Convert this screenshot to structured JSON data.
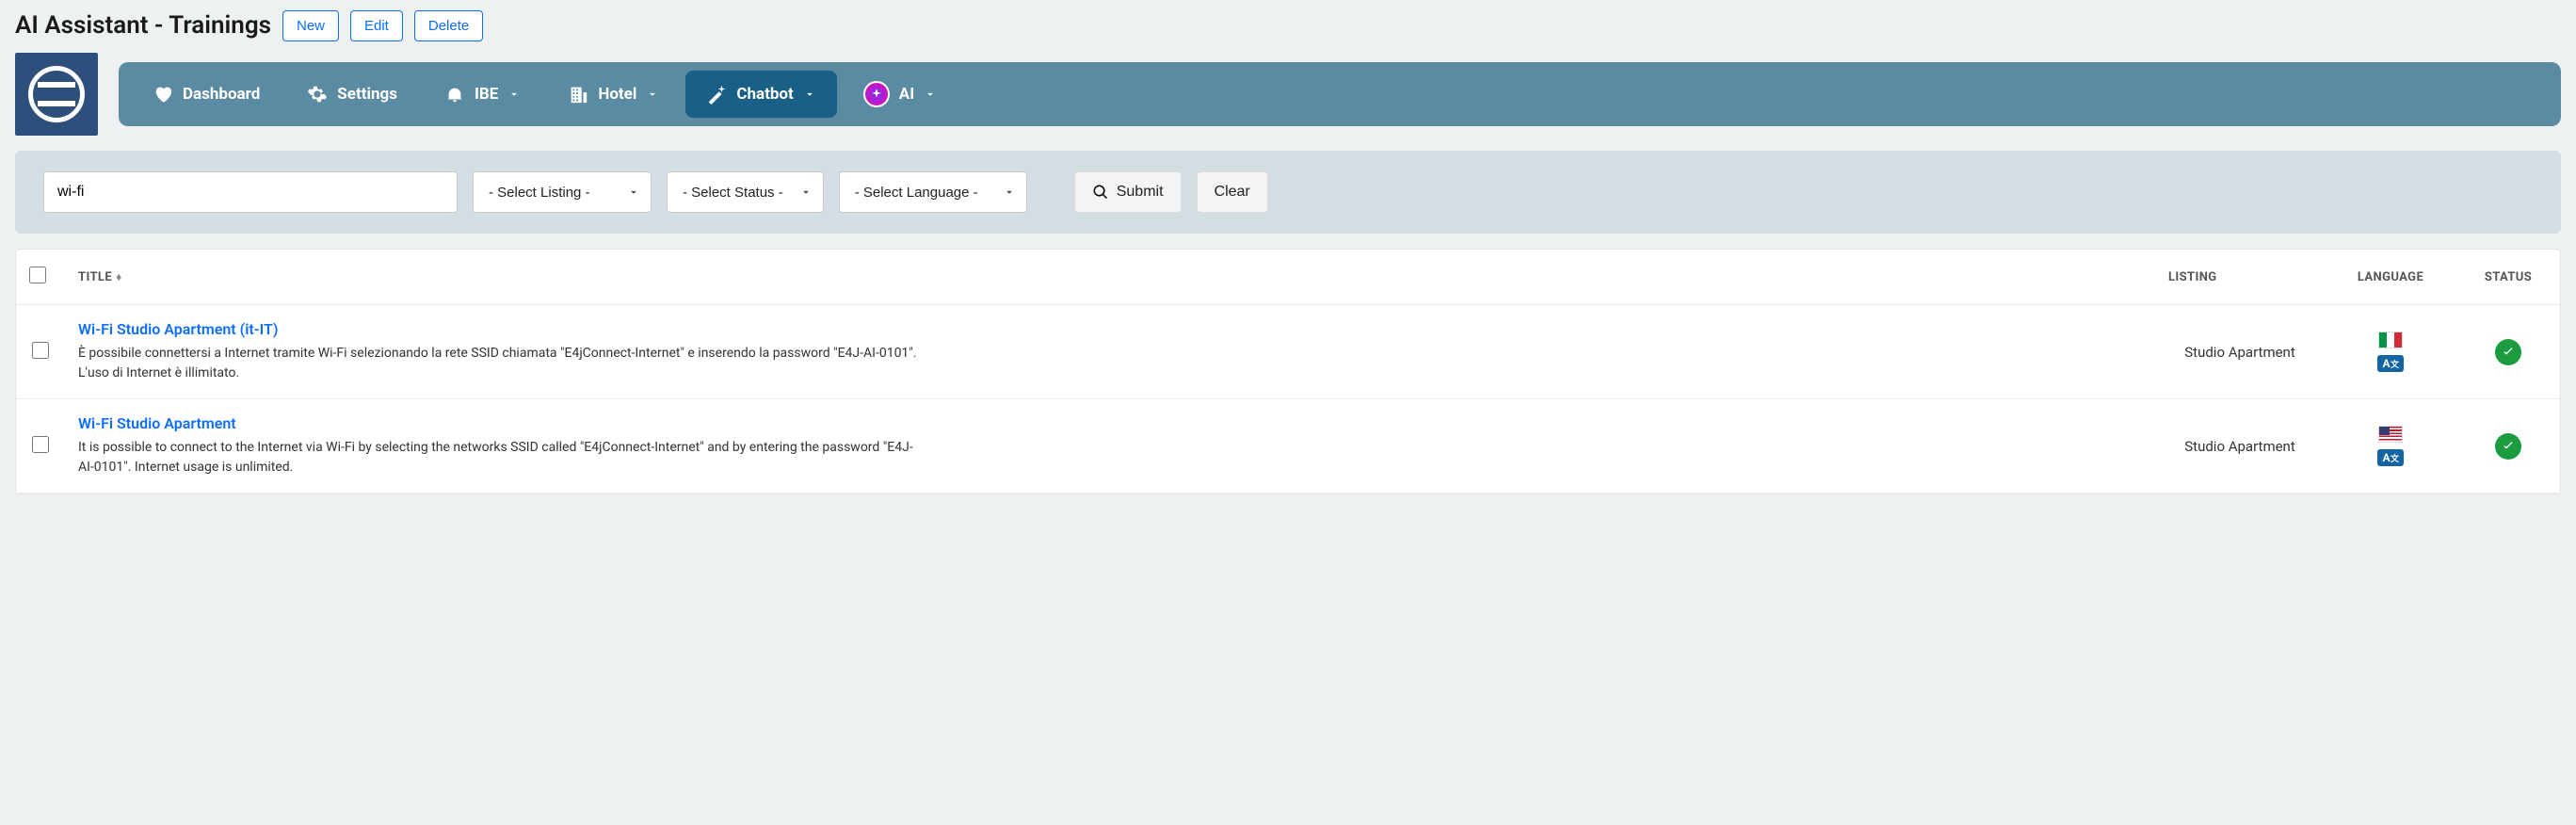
{
  "page": {
    "title": "AI Assistant - Trainings"
  },
  "actions": {
    "new": "New",
    "edit": "Edit",
    "delete": "Delete"
  },
  "nav": {
    "dashboard": "Dashboard",
    "settings": "Settings",
    "ibe": "IBE",
    "hotel": "Hotel",
    "chatbot": "Chatbot",
    "ai": "AI"
  },
  "filters": {
    "search_value": "wi-fi",
    "listing_placeholder": "- Select Listing -",
    "status_placeholder": "- Select Status -",
    "language_placeholder": "- Select Language -",
    "submit": "Submit",
    "clear": "Clear"
  },
  "table": {
    "headers": {
      "title": "TITLE",
      "listing": "LISTING",
      "language": "LANGUAGE",
      "status": "STATUS"
    },
    "rows": [
      {
        "title": "Wi-Fi Studio Apartment (it-IT)",
        "desc": "È possibile connettersi a Internet tramite Wi-Fi selezionando la rete SSID chiamata \"E4jConnect-Internet\" e inserendo la password \"E4J-AI-0101\". L'uso di Internet è illimitato.",
        "listing": "Studio Apartment",
        "flag": "it",
        "status": "ok"
      },
      {
        "title": "Wi-Fi Studio Apartment",
        "desc": "It is possible to connect to the Internet via Wi-Fi by selecting the networks SSID called \"E4jConnect-Internet\" and by entering the password \"E4J-AI-0101\". Internet usage is unlimited.",
        "listing": "Studio Apartment",
        "flag": "us",
        "status": "ok"
      }
    ]
  }
}
